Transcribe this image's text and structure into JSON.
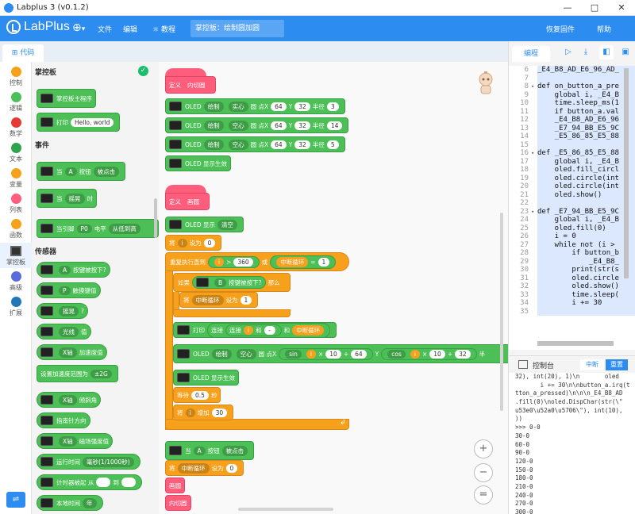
{
  "window": {
    "title": "Labplus 3 (v0.1.2)",
    "min": "—",
    "max": "□",
    "close": "✕"
  },
  "menubar": {
    "logo": "LabPlus",
    "lang_arrow": "▾",
    "items": {
      "file": "文件",
      "edit": "编辑",
      "tutorial": "教程"
    },
    "breadcrumb": "掌控板：绘制圆加圆",
    "restore": "恢复固件",
    "help": "帮助"
  },
  "tabs": {
    "code": "代码"
  },
  "categories": [
    {
      "label": "控制",
      "color": "#f7a01c"
    },
    {
      "label": "逻辑",
      "color": "#4cbf56"
    },
    {
      "label": "数学",
      "color": "#e53935"
    },
    {
      "label": "文本",
      "color": "#2ea44f"
    },
    {
      "label": "变量",
      "color": "#f7a01c"
    },
    {
      "label": "列表",
      "color": "#fe5d7c"
    },
    {
      "label": "函数",
      "color": "#f7a01c"
    },
    {
      "label": "掌控板",
      "color": "#333333"
    },
    {
      "label": "高级",
      "color": "#5b6bde"
    },
    {
      "label": "扩展",
      "color": "#2177b8"
    }
  ],
  "flyout": {
    "section_board": "掌控板",
    "main_program": "掌控板主程序",
    "print": "打印",
    "print_value": "Hello, world",
    "section_events": "事件",
    "when": "当",
    "button_a": "A",
    "button_word": "按钮",
    "pressed": "被点击",
    "shake": "摇晃",
    "shake_when": "时",
    "pin_prefix": "当引脚",
    "pin": "P0",
    "level": "电平",
    "low_high": "从低到高",
    "section_sensors": "传感器",
    "a_pressed": "按键被按下?",
    "p": "P",
    "touched": "触摸键值",
    "shaken": "摇晃",
    "q": "?",
    "light": "光线",
    "value": "值",
    "x_axis": "X轴",
    "accel": "加速度值",
    "set_accel": "设置加速度范围为",
    "g2": "±2G",
    "tilt": "倾斜角",
    "compass": "指南针方向",
    "mag": "磁场强度值",
    "runtime": "运行时间",
    "ms": "毫秒(1/1000秒)",
    "timer": "计时器被起 从",
    "to": "到",
    "local_time": "本地时间",
    "year": "年"
  },
  "workspace": {
    "def": "定义",
    "fn_inner": "内切圆",
    "fn_draw": "画圆",
    "oled": "OLED",
    "draw": "绘制",
    "solid": "实心",
    "hollow": "空心",
    "circle_x": "圆 点X",
    "y": "Y",
    "radius": "半径",
    "c1": {
      "x": "64",
      "y": "32",
      "r": "3"
    },
    "c2": {
      "x": "64",
      "y": "32",
      "r": "14"
    },
    "c3": {
      "x": "64",
      "y": "32",
      "r": "5"
    },
    "oled_show": "OLED 显示生效",
    "oled_display": "OLED 显示",
    "clear": "清空",
    "set_prefix": "将",
    "var_i": "i",
    "set_to": "设为",
    "zero": "0",
    "repeat_until": "重复执行直到",
    "gt": ">",
    "n360": "360",
    "or": "或",
    "break_loop": "中断循环",
    "eq": "=",
    "one": "1",
    "if": "如果",
    "b": "B",
    "b_pressed": "按键被按下?",
    "then": "那么",
    "print": "打印",
    "join1": "连接",
    "join2": "连接",
    "and": "和",
    "dash": "-",
    "sin": "sin",
    "cos": "cos",
    "ten": "10",
    "n64": "64",
    "n32": "32",
    "half": "半",
    "wait": "等待",
    "wait_s": "0.5",
    "sec": "秒",
    "inc": "增加",
    "n30": "30",
    "when": "当",
    "a": "A",
    "button": "按钮",
    "clicked": "被点击",
    "call_inner": "内切圆",
    "zoom_in": "+",
    "zoom_out": "−",
    "menu": "="
  },
  "right": {
    "edit_tab": "编程",
    "console_title": "控制台",
    "interrupt": "中断",
    "restart": "重置",
    "code_lines": [
      {
        "n": "6",
        "t": "_E4_B8_AD_E6_96_AD_"
      },
      {
        "n": "7",
        "t": ""
      },
      {
        "n": "8",
        "t": "def on_button_a_pre"
      },
      {
        "n": "9",
        "t": "    global i, _E4_B"
      },
      {
        "n": "10",
        "t": "    time.sleep_ms(1"
      },
      {
        "n": "11",
        "t": "    if button_a.val"
      },
      {
        "n": "12",
        "t": "    _E4_B8_AD_E6_96"
      },
      {
        "n": "13",
        "t": "    _E7_94_BB_E5_9C"
      },
      {
        "n": "14",
        "t": "    _E5_86_85_E5_88"
      },
      {
        "n": "15",
        "t": ""
      },
      {
        "n": "16",
        "t": "def _E5_86_85_E5_88"
      },
      {
        "n": "17",
        "t": "    global i, _E4_B"
      },
      {
        "n": "18",
        "t": "    oled.fill_circl"
      },
      {
        "n": "19",
        "t": "    oled.circle(int"
      },
      {
        "n": "20",
        "t": "    oled.circle(int"
      },
      {
        "n": "21",
        "t": "    oled.show()"
      },
      {
        "n": "22",
        "t": ""
      },
      {
        "n": "23",
        "t": "def _E7_94_BB_E5_9C"
      },
      {
        "n": "24",
        "t": "    global i, _E4_B"
      },
      {
        "n": "25",
        "t": "    oled.fill(0)"
      },
      {
        "n": "26",
        "t": "    i = 0"
      },
      {
        "n": "27",
        "t": "    while not (i >"
      },
      {
        "n": "28",
        "t": "        if button_b"
      },
      {
        "n": "29",
        "t": "            _E4_B8_"
      },
      {
        "n": "30",
        "t": "        print(str(s"
      },
      {
        "n": "31",
        "t": "        oled.circle"
      },
      {
        "n": "32",
        "t": "        oled.show()"
      },
      {
        "n": "33",
        "t": "        time.sleep("
      },
      {
        "n": "34",
        "t": "        i += 30"
      },
      {
        "n": "35",
        "t": ""
      }
    ],
    "console_lines": [
      "32), int(20), 1)\\n       oled",
      "       i += 30\\n\\nbutton_a.irq(t",
      "tton_a_pressed)\\n\\n\\n_E4_B8_AD",
      ".fill(0)\\noled.DispChar(str(\\\"",
      "u53e0\\u52a0\\u5706\\\"), int(10),",
      "))",
      ">>> 0-0",
      "30-0",
      "60-0",
      "90-0",
      "120-0",
      "150-0",
      "180-0",
      "210-0",
      "240-0",
      "270-0",
      "300-0",
      "330-0",
      "360-0"
    ]
  }
}
